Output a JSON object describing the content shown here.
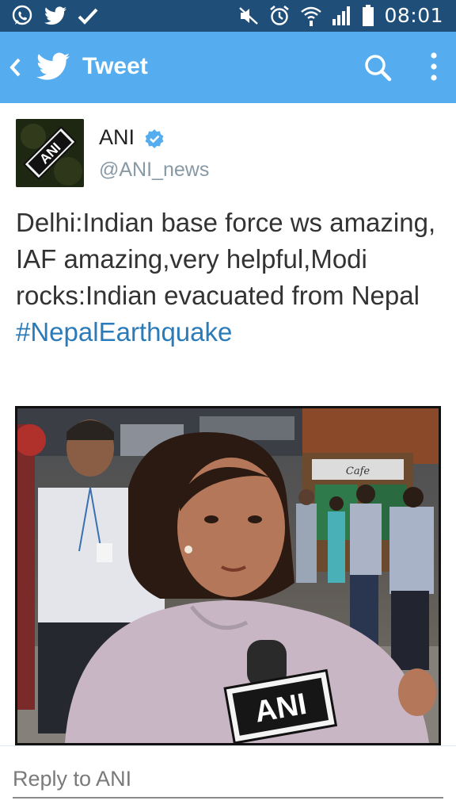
{
  "status_bar": {
    "time": "08:01",
    "left_icons": [
      "whatsapp-icon",
      "twitter-icon",
      "check-icon"
    ],
    "right_icons": [
      "mute-icon",
      "alarm-icon",
      "wifi-icon",
      "signal-icon",
      "battery-icon"
    ]
  },
  "action_bar": {
    "title": "Tweet",
    "icons": [
      "back-icon",
      "twitter-bird-icon",
      "search-icon",
      "overflow-menu-icon"
    ]
  },
  "tweet": {
    "author_name": "ANI",
    "author_handle": "@ANI_news",
    "avatar_text": "ANI",
    "text": "Delhi:Indian base force ws amazing, IAF amazing,very helpful,Modi rocks:Indian evacuated from Nepal",
    "hashtag": "#NepalEarthquake",
    "media": {
      "mic_label": "ANI",
      "sign_text": "Cafe"
    }
  },
  "reply": {
    "placeholder": "Reply to ANI"
  },
  "colors": {
    "status_bar": "#1f4f78",
    "action_bar": "#55acee",
    "hashtag": "#2b7bb9",
    "verified": "#55acee",
    "handle": "#8899a6"
  }
}
